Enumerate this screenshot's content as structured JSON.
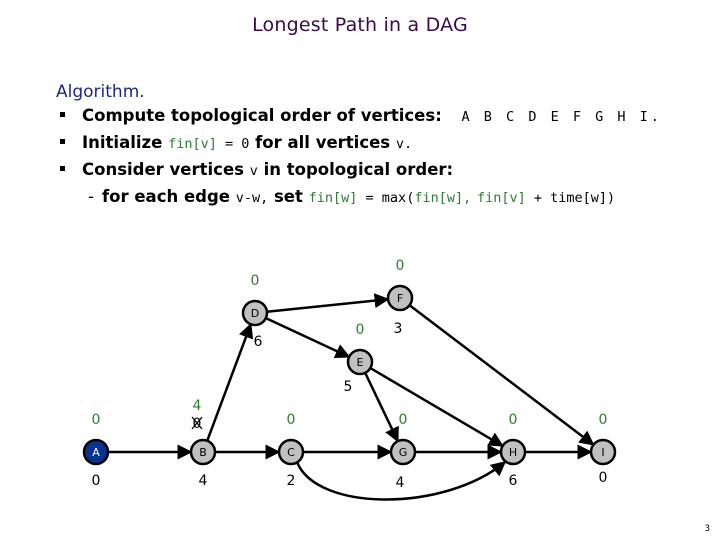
{
  "title": "Longest Path in a DAG",
  "heading": "Algorithm.",
  "bullets": [
    {
      "text": "Compute topological order of vertices:",
      "code": "A B C D E F G H I."
    },
    {
      "text_before": "Initialize",
      "code_green": "fin[v]",
      "code_eq": " = 0",
      "text_after": "for all vertices",
      "code_v": "v."
    },
    {
      "text_before": "Consider vertices",
      "code_v": "v",
      "text_after": "in topological order:"
    }
  ],
  "sub_bullet": {
    "dash": "-",
    "text_before": "for each edge",
    "code_edge": "v-w,",
    "text_set": "set",
    "code_finw": "fin[w]",
    "code_eqmax": " = max(",
    "code_finw2": "fin[w],",
    "code_finv": "fin[v]",
    "code_plus": " + time[w])"
  },
  "graph": {
    "colors": {
      "node_fill": "#c0c0c0",
      "start_fill": "#0a3290",
      "fin_label": "#2e7d32",
      "time_label": "#000000"
    },
    "nodes": [
      {
        "id": "A",
        "fin": "0",
        "time": "0",
        "active": true
      },
      {
        "id": "B",
        "fin": "4",
        "fin_old": "0",
        "time": "4",
        "active": false
      },
      {
        "id": "C",
        "fin": "0",
        "time": "2",
        "active": false
      },
      {
        "id": "D",
        "fin": "0",
        "time": "6",
        "active": false
      },
      {
        "id": "E",
        "fin": "0",
        "time": "5",
        "active": false
      },
      {
        "id": "F",
        "fin": "0",
        "time": "3",
        "active": false
      },
      {
        "id": "G",
        "fin": "0",
        "time": "4",
        "active": false
      },
      {
        "id": "H",
        "fin": "0",
        "time": "6",
        "active": false
      },
      {
        "id": "I",
        "fin": "0",
        "time": "0",
        "active": false
      }
    ],
    "edges": [
      [
        "A",
        "B"
      ],
      [
        "B",
        "C"
      ],
      [
        "B",
        "D"
      ],
      [
        "C",
        "G"
      ],
      [
        "C",
        "H"
      ],
      [
        "D",
        "F"
      ],
      [
        "D",
        "E"
      ],
      [
        "E",
        "G"
      ],
      [
        "E",
        "H"
      ],
      [
        "F",
        "I"
      ],
      [
        "G",
        "H"
      ],
      [
        "H",
        "I"
      ]
    ]
  },
  "page_number": "3"
}
